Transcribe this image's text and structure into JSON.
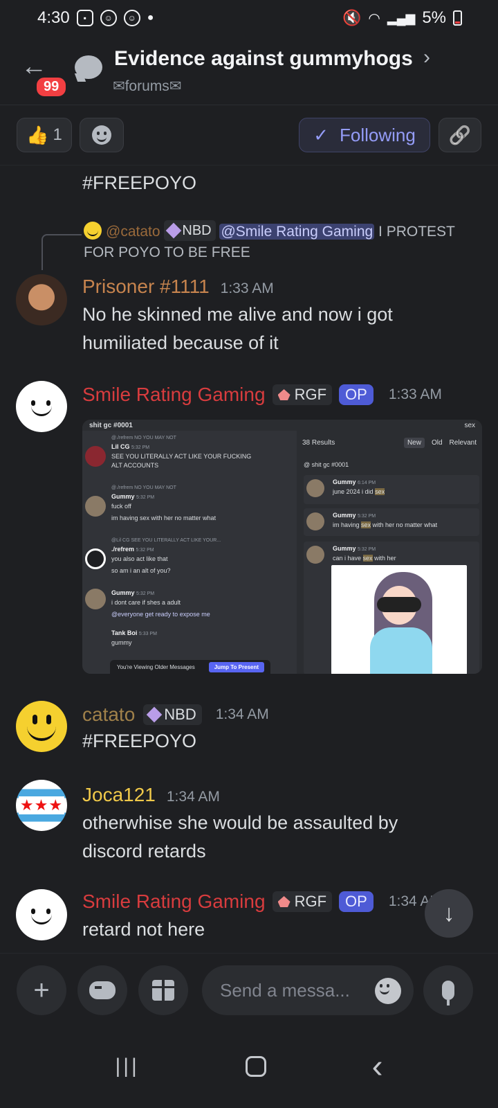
{
  "status": {
    "time": "4:30",
    "battery": "5%"
  },
  "header": {
    "back_badge": "99",
    "title": "Evidence against gummyhogs",
    "subtitle": "✉forums✉"
  },
  "actions": {
    "reaction_count": "1",
    "reaction_emoji": "👍",
    "following_label": "Following",
    "check": "✓",
    "link_icon": "🔗"
  },
  "messages": [
    {
      "text": "#FREEPOYO"
    },
    {
      "reply": {
        "author": "@catato",
        "tag": "NBD",
        "mention": "@Smile Rating Gaming",
        "text": " I PROTEST FOR POYO TO BE FREE"
      },
      "author": "Prisoner #1111",
      "author_color": "#c7844e",
      "time": "1:33 AM",
      "text": "No he skinned me alive and now i got humiliated because of it"
    },
    {
      "author": "Smile Rating Gaming",
      "author_color": "#d83c3e",
      "time": "1:33 AM",
      "tag": "RGF",
      "op": "OP",
      "screenshot": {
        "channel": "shit gc #0001",
        "search_term": "sex",
        "left": [
          {
            "ref": "@./refrem  NO YOU MAY NOT",
            "name": "Lil CG",
            "time": "5:32 PM",
            "lines": [
              "SEE YOU LITERALLY ACT LIKE YOUR FUCKING",
              "ALT ACCOUNTS"
            ]
          },
          {
            "ref": "@./refrem  NO YOU MAY NOT",
            "name": "Gummy",
            "time": "5:32 PM",
            "lines": [
              "fuck off",
              "im having sex with her no matter what"
            ]
          },
          {
            "ref": "@Lil CG  SEE YOU LITERALLY ACT LIKE YOUR...",
            "name": "./refrem",
            "time": "5:32 PM",
            "lines": [
              "you also act like that",
              "so am i an alt of you?"
            ]
          },
          {
            "ref": "",
            "name": "Gummy",
            "time": "5:32 PM",
            "lines": [
              "i dont care if shes a adult",
              "@everyone get ready to expose me"
            ]
          },
          {
            "ref": "",
            "name": "Tank Boi",
            "time": "5:33 PM",
            "lines": [
              "gummy"
            ]
          }
        ],
        "older_text": "You're Viewing Older Messages",
        "jump_label": "Jump To Present",
        "results_count": "38 Results",
        "tabs": [
          "New",
          "Old",
          "Relevant"
        ],
        "results_channel": "@ shit gc #0001",
        "results": [
          {
            "name": "Gummy",
            "time": "6:14 PM",
            "pre": "june 2024 i did ",
            "hl": "sex",
            "post": ""
          },
          {
            "name": "Gummy",
            "time": "5:32 PM",
            "pre": "im having ",
            "hl": "sex",
            "post": " with her no matter what"
          },
          {
            "name": "Gummy",
            "time": "5:32 PM",
            "pre": "can i have ",
            "hl": "sex",
            "post": " with her"
          }
        ]
      }
    },
    {
      "author": "catato",
      "author_color": "#a0814a",
      "time": "1:34 AM",
      "tag": "NBD",
      "text": "#FREEPOYO"
    },
    {
      "author": "Joca121",
      "author_color": "#f0c94a",
      "time": "1:34 AM",
      "text": "otherwhise she would be assaulted by discord retards"
    },
    {
      "author": "Smile Rating Gaming",
      "author_color": "#d83c3e",
      "time": "1:34 AM",
      "tag": "RGF",
      "op": "OP",
      "text": "retard not here"
    }
  ],
  "composer": {
    "placeholder": "Send a messa..."
  },
  "nav": {
    "recents": "|||",
    "back": "‹"
  }
}
